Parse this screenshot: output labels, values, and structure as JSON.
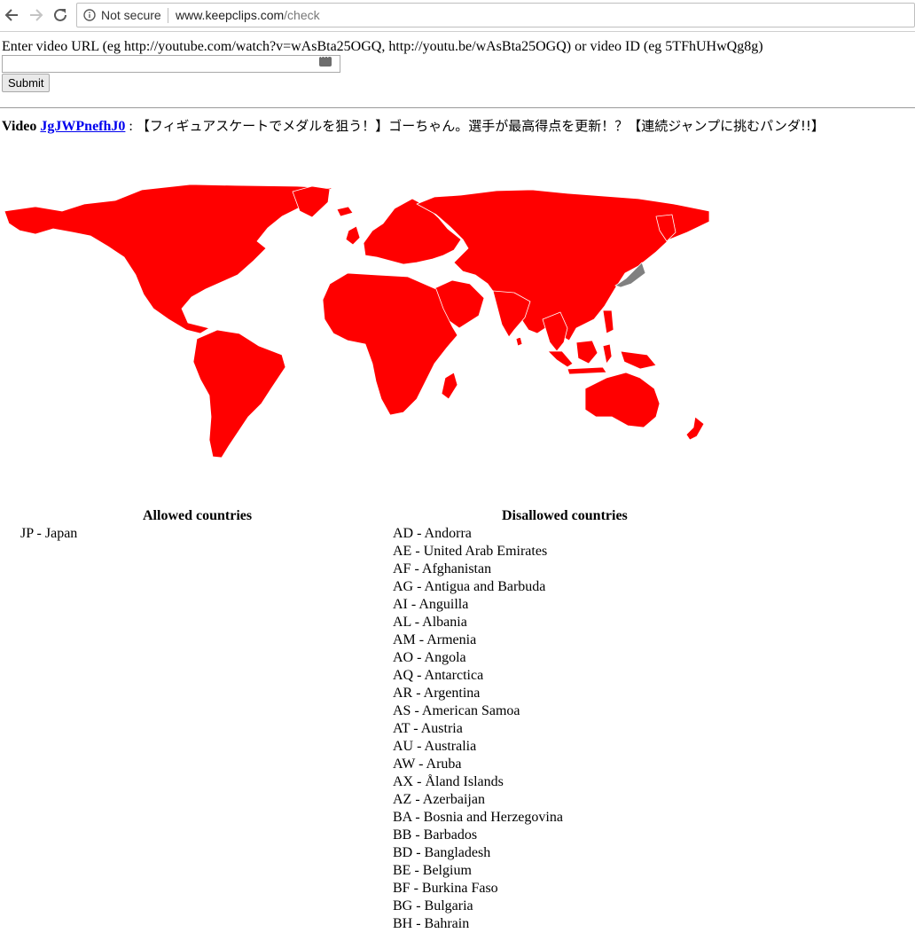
{
  "browser": {
    "security_label": "Not secure",
    "url_host": "www.keepclips.com",
    "url_path": "/check"
  },
  "form": {
    "prompt": "Enter video URL (eg http://youtube.com/watch?v=wAsBta25OGQ, http://youtu.be/wAsBta25OGQ) or video ID (eg 5TFhUHwQg8g)",
    "input_value": "",
    "submit_label": "Submit"
  },
  "video": {
    "label": "Video",
    "id": "JgJWPnefhJ0",
    "separator": " : ",
    "title": "【フィギュアスケートでメダルを狙う！】ゴーちゃん。選手が最高得点を更新！？【連続ジャンプに挑むパンダ!!】"
  },
  "map": {
    "blocked_color": "#ff0000",
    "allowed_color": "#808080",
    "border_color": "#ffffff"
  },
  "countries": {
    "allowed_heading": "Allowed countries",
    "disallowed_heading": "Disallowed countries",
    "allowed": [
      "JP - Japan"
    ],
    "disallowed": [
      "AD - Andorra",
      "AE - United Arab Emirates",
      "AF - Afghanistan",
      "AG - Antigua and Barbuda",
      "AI - Anguilla",
      "AL - Albania",
      "AM - Armenia",
      "AO - Angola",
      "AQ - Antarctica",
      "AR - Argentina",
      "AS - American Samoa",
      "AT - Austria",
      "AU - Australia",
      "AW - Aruba",
      "AX - Åland Islands",
      "AZ - Azerbaijan",
      "BA - Bosnia and Herzegovina",
      "BB - Barbados",
      "BD - Bangladesh",
      "BE - Belgium",
      "BF - Burkina Faso",
      "BG - Bulgaria",
      "BH - Bahrain"
    ]
  }
}
